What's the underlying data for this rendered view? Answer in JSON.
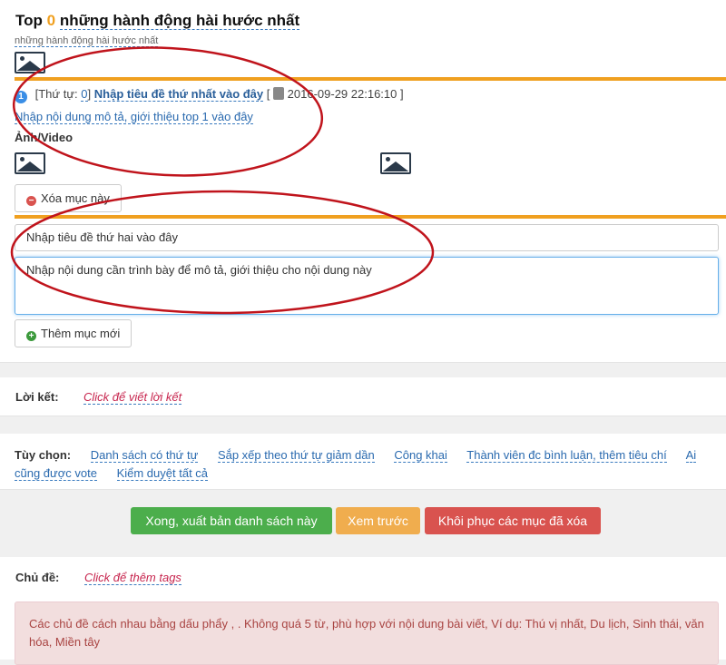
{
  "header": {
    "title_prefix": "Top",
    "count": "0",
    "title": "những hành động hài hước nhất",
    "subtitle": "những hành động hài hước nhất"
  },
  "item1": {
    "badge": "1",
    "order_label": "[Thứ tự:",
    "order_value": "0",
    "order_close": "]",
    "title": "Nhập tiêu đề thứ nhất vào đây",
    "open_bracket": "[",
    "timestamp": "2016-09-29 22:16:10 ]",
    "description": "Nhập nội dung mô tả, giới thiệu top 1 vào đây",
    "media_label": "Ảnh/Video",
    "delete_label": "Xóa mục này"
  },
  "item2": {
    "title_value": "Nhập tiêu đề thứ hai vào đây",
    "content_value": "Nhập nội dung cần trình bày để mô tả, giới thiệu cho nội dung này",
    "add_label": "Thêm mục mới"
  },
  "closing": {
    "label": "Lời kết:",
    "placeholder": "Click để viết lời kết"
  },
  "options": {
    "label": "Tùy chọn:",
    "items": [
      "Danh sách có thứ tự",
      "Sắp xếp theo thứ tự giảm dần",
      "Công khai",
      "Thành viên đc bình luận, thêm tiêu chí",
      "Ai cũng được vote",
      "Kiểm duyệt tất cả"
    ]
  },
  "actions": {
    "publish": "Xong, xuất bản danh sách này",
    "preview": "Xem trước",
    "restore": "Khôi phục các mục đã xóa"
  },
  "tags": {
    "label": "Chủ đề:",
    "placeholder": "Click để thêm tags",
    "hint": "Các chủ đề cách nhau bằng dấu phẩy , . Không quá 5 từ, phù hợp với nội dung bài viết, Ví dụ: Thú vị nhất, Du lịch, Sinh thái, văn hóa, Miền tây"
  },
  "colors": {
    "accent_bar": "#f0a020",
    "publish": "#4cae4c",
    "preview": "#f0ad4e",
    "restore": "#d9534f",
    "annotation": "#c0141c"
  }
}
